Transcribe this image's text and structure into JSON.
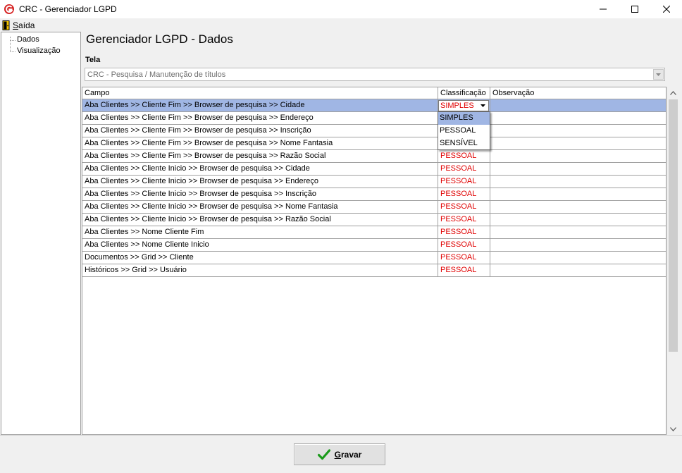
{
  "window": {
    "title": "CRC - Gerenciador LGPD"
  },
  "menu": {
    "exit_label": "Saída"
  },
  "tree": {
    "items": [
      "Dados",
      "Visualização"
    ]
  },
  "page": {
    "title": "Gerenciador LGPD - Dados",
    "tela_label": "Tela",
    "tela_value": "CRC - Pesquisa / Manutenção de títulos"
  },
  "grid": {
    "columns": [
      "Campo",
      "Classificação",
      "Observação"
    ],
    "rows": [
      {
        "campo": "Aba Clientes >> Cliente Fim >> Browser de pesquisa >> Cidade",
        "classificacao": "SIMPLES",
        "observacao": ""
      },
      {
        "campo": "Aba Clientes >> Cliente Fim >> Browser de pesquisa >> Endereço",
        "classificacao": "",
        "observacao": ""
      },
      {
        "campo": "Aba Clientes >> Cliente Fim >> Browser de pesquisa >> Inscrição",
        "classificacao": "",
        "observacao": ""
      },
      {
        "campo": "Aba Clientes >> Cliente Fim >> Browser de pesquisa >> Nome Fantasia",
        "classificacao": "",
        "observacao": ""
      },
      {
        "campo": "Aba Clientes >> Cliente Fim >> Browser de pesquisa >> Razão Social",
        "classificacao": "PESSOAL",
        "observacao": ""
      },
      {
        "campo": "Aba Clientes >> Cliente Inicio >> Browser de pesquisa >> Cidade",
        "classificacao": "PESSOAL",
        "observacao": ""
      },
      {
        "campo": "Aba Clientes >> Cliente Inicio >> Browser de pesquisa >> Endereço",
        "classificacao": "PESSOAL",
        "observacao": ""
      },
      {
        "campo": "Aba Clientes >> Cliente Inicio >> Browser de pesquisa >> Inscrição",
        "classificacao": "PESSOAL",
        "observacao": ""
      },
      {
        "campo": "Aba Clientes >> Cliente Inicio >> Browser de pesquisa >> Nome Fantasia",
        "classificacao": "PESSOAL",
        "observacao": ""
      },
      {
        "campo": "Aba Clientes >> Cliente Inicio >> Browser de pesquisa >> Razão Social",
        "classificacao": "PESSOAL",
        "observacao": ""
      },
      {
        "campo": "Aba Clientes >> Nome Cliente Fim",
        "classificacao": "PESSOAL",
        "observacao": ""
      },
      {
        "campo": "Aba Clientes >> Nome Cliente Inicio",
        "classificacao": "PESSOAL",
        "observacao": ""
      },
      {
        "campo": "Documentos >> Grid >> Cliente",
        "classificacao": "PESSOAL",
        "observacao": ""
      },
      {
        "campo": "Históricos >> Grid >> Usuário",
        "classificacao": "PESSOAL",
        "observacao": ""
      }
    ],
    "dropdown_options": [
      "SIMPLES",
      "PESSOAL",
      "SENSÍVEL"
    ],
    "dropdown_selected": "SIMPLES"
  },
  "footer": {
    "save_label": "Gravar"
  },
  "colors": {
    "selection": "#a0b6e4",
    "classification_text": "#e00000",
    "save_check": "#1a9a1a"
  }
}
